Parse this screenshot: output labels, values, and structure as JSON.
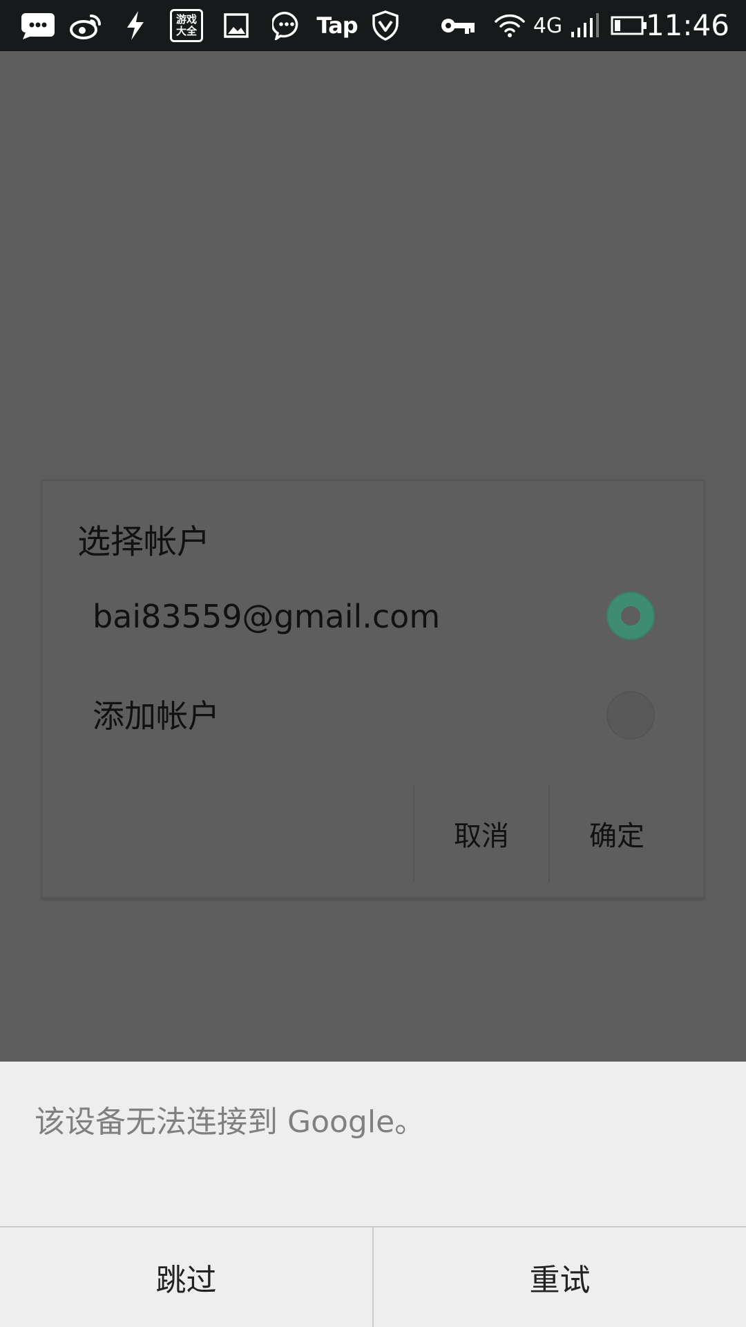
{
  "status_bar": {
    "tap_label": "Tap",
    "game_label_line1": "游戏",
    "game_label_line2": "大全",
    "network_label": "4G",
    "time": "11:46"
  },
  "dialog": {
    "title": "选择帐户",
    "options": [
      {
        "label": "bai83559@gmail.com",
        "selected": true
      },
      {
        "label": "添加帐户",
        "selected": false
      }
    ],
    "cancel_label": "取消",
    "confirm_label": "确定"
  },
  "bottom_sheet": {
    "message": "该设备无法连接到 Google。",
    "skip_label": "跳过",
    "retry_label": "重试"
  },
  "colors": {
    "status_bar_bg": "#161a1b",
    "overlay_bg": "#5e5e5e",
    "radio_accent": "#3f8c73",
    "sheet_bg": "#eeeeee"
  }
}
